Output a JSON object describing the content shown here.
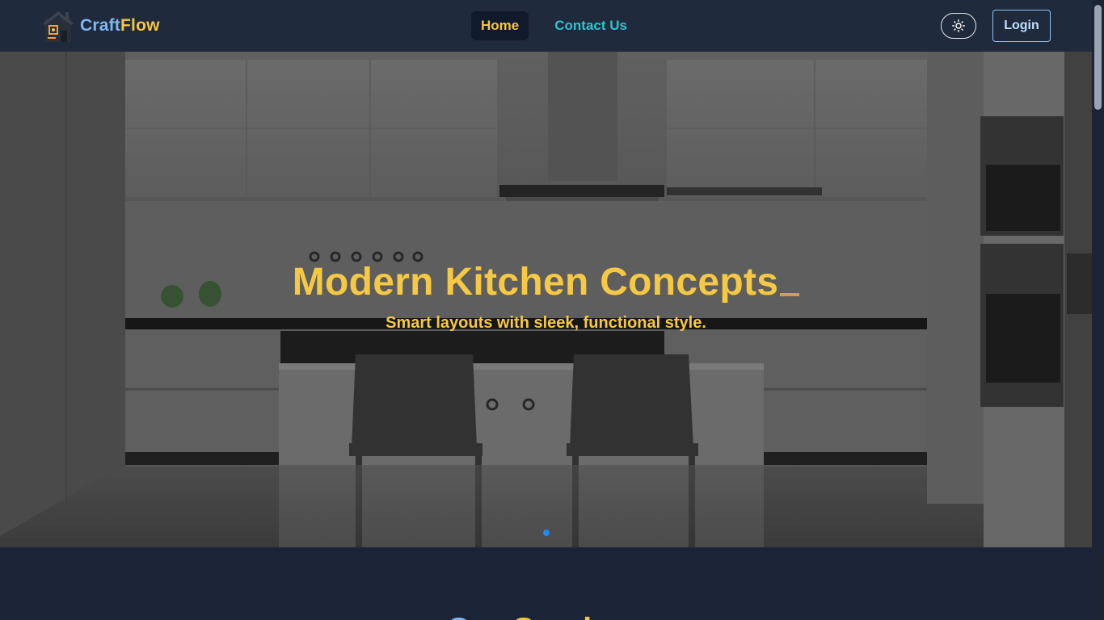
{
  "brand": {
    "name_part1": "Craft",
    "name_part2": "Flow"
  },
  "nav": {
    "items": [
      {
        "label": "Home",
        "active": true
      },
      {
        "label": "Contact Us",
        "active": false
      }
    ],
    "theme_toggle_icon": "sun-icon",
    "login_label": "Login"
  },
  "hero": {
    "title": "Modern Kitchen Concepts",
    "subtitle": "Smart layouts with sleek, functional style.",
    "slides_count": 1,
    "active_slide": 1
  },
  "next_section": {
    "heading_part1": "Our",
    "heading_part2": "Services"
  },
  "colors": {
    "accent_yellow": "#f3c63f",
    "accent_cyan": "#2cc4cf",
    "accent_blue": "#7fb8f0",
    "nav_bg": "#1f2a3d",
    "page_bg": "#1b2436",
    "dot_active": "#1e8bff"
  }
}
